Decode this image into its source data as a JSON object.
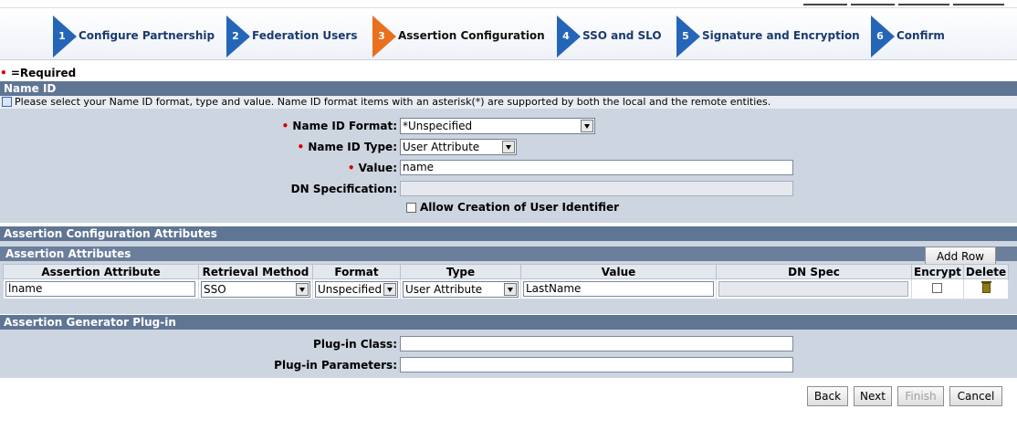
{
  "wizard": {
    "steps": [
      {
        "num": "1",
        "label": "Configure Partnership",
        "state": "done"
      },
      {
        "num": "2",
        "label": "Federation Users",
        "state": "done"
      },
      {
        "num": "3",
        "label": "Assertion Configuration",
        "state": "active"
      },
      {
        "num": "4",
        "label": "SSO and SLO",
        "state": "todo"
      },
      {
        "num": "5",
        "label": "Signature and Encryption",
        "state": "todo"
      },
      {
        "num": "6",
        "label": "Confirm",
        "state": "todo"
      }
    ]
  },
  "required_note": {
    "dot": "•",
    "text": "=Required"
  },
  "name_id": {
    "title": "Name ID",
    "info": "Please select your Name ID format, type and value. Name ID format items with an asterisk(*) are supported by both the local and the remote entities.",
    "format_label": "Name ID Format:",
    "format_value": "*Unspecified",
    "type_label": "Name ID Type:",
    "type_value": "User Attribute",
    "value_label": "Value:",
    "value_value": "name",
    "dn_label": "DN Specification:",
    "dn_value": "",
    "allow_label": "Allow Creation of User Identifier"
  },
  "assertion_config": {
    "title": "Assertion Configuration Attributes",
    "subtitle": "Assertion Attributes",
    "add_row": "Add Row",
    "columns": [
      "Assertion Attribute",
      "Retrieval Method",
      "Format",
      "Type",
      "Value",
      "DN Spec",
      "Encrypt",
      "Delete"
    ],
    "rows": [
      {
        "attribute": "lname",
        "retrieval": "SSO",
        "format": "Unspecified",
        "type": "User Attribute",
        "value": "LastName",
        "dn_spec": ""
      }
    ]
  },
  "plugin": {
    "title": "Assertion Generator Plug-in",
    "class_label": "Plug-in Class:",
    "class_value": "",
    "params_label": "Plug-in Parameters:",
    "params_value": ""
  },
  "footer": {
    "back": "Back",
    "next": "Next",
    "finish": "Finish",
    "cancel": "Cancel"
  },
  "colors": {
    "step_blue": "#2565b8",
    "step_orange": "#e8701f",
    "section_bar": "#5f7594",
    "panel_bg": "#cdd5e0",
    "required_dot": "#d40000"
  }
}
